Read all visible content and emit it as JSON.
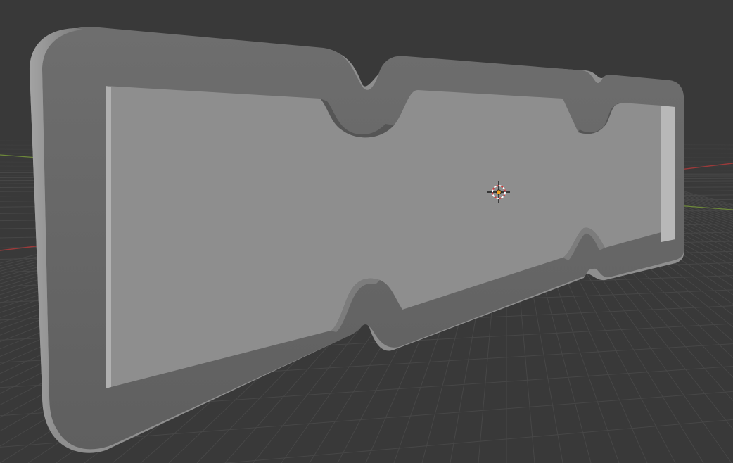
{
  "viewport": {
    "background_color": "#393939",
    "grid_color": "#474747",
    "x_axis_color": "#9b3a3a",
    "y_axis_color": "#6e8a3a",
    "mesh_color": "#6a6a6a",
    "mesh_shade_color": "#8a8a8a",
    "origin_marker_colors": [
      "#ffffff",
      "#d23c3c",
      "#f0a020"
    ]
  },
  "scene": {
    "object": "rounded-rectangular-frame-mesh",
    "origin_marker_icon": "3d-cursor-icon"
  }
}
